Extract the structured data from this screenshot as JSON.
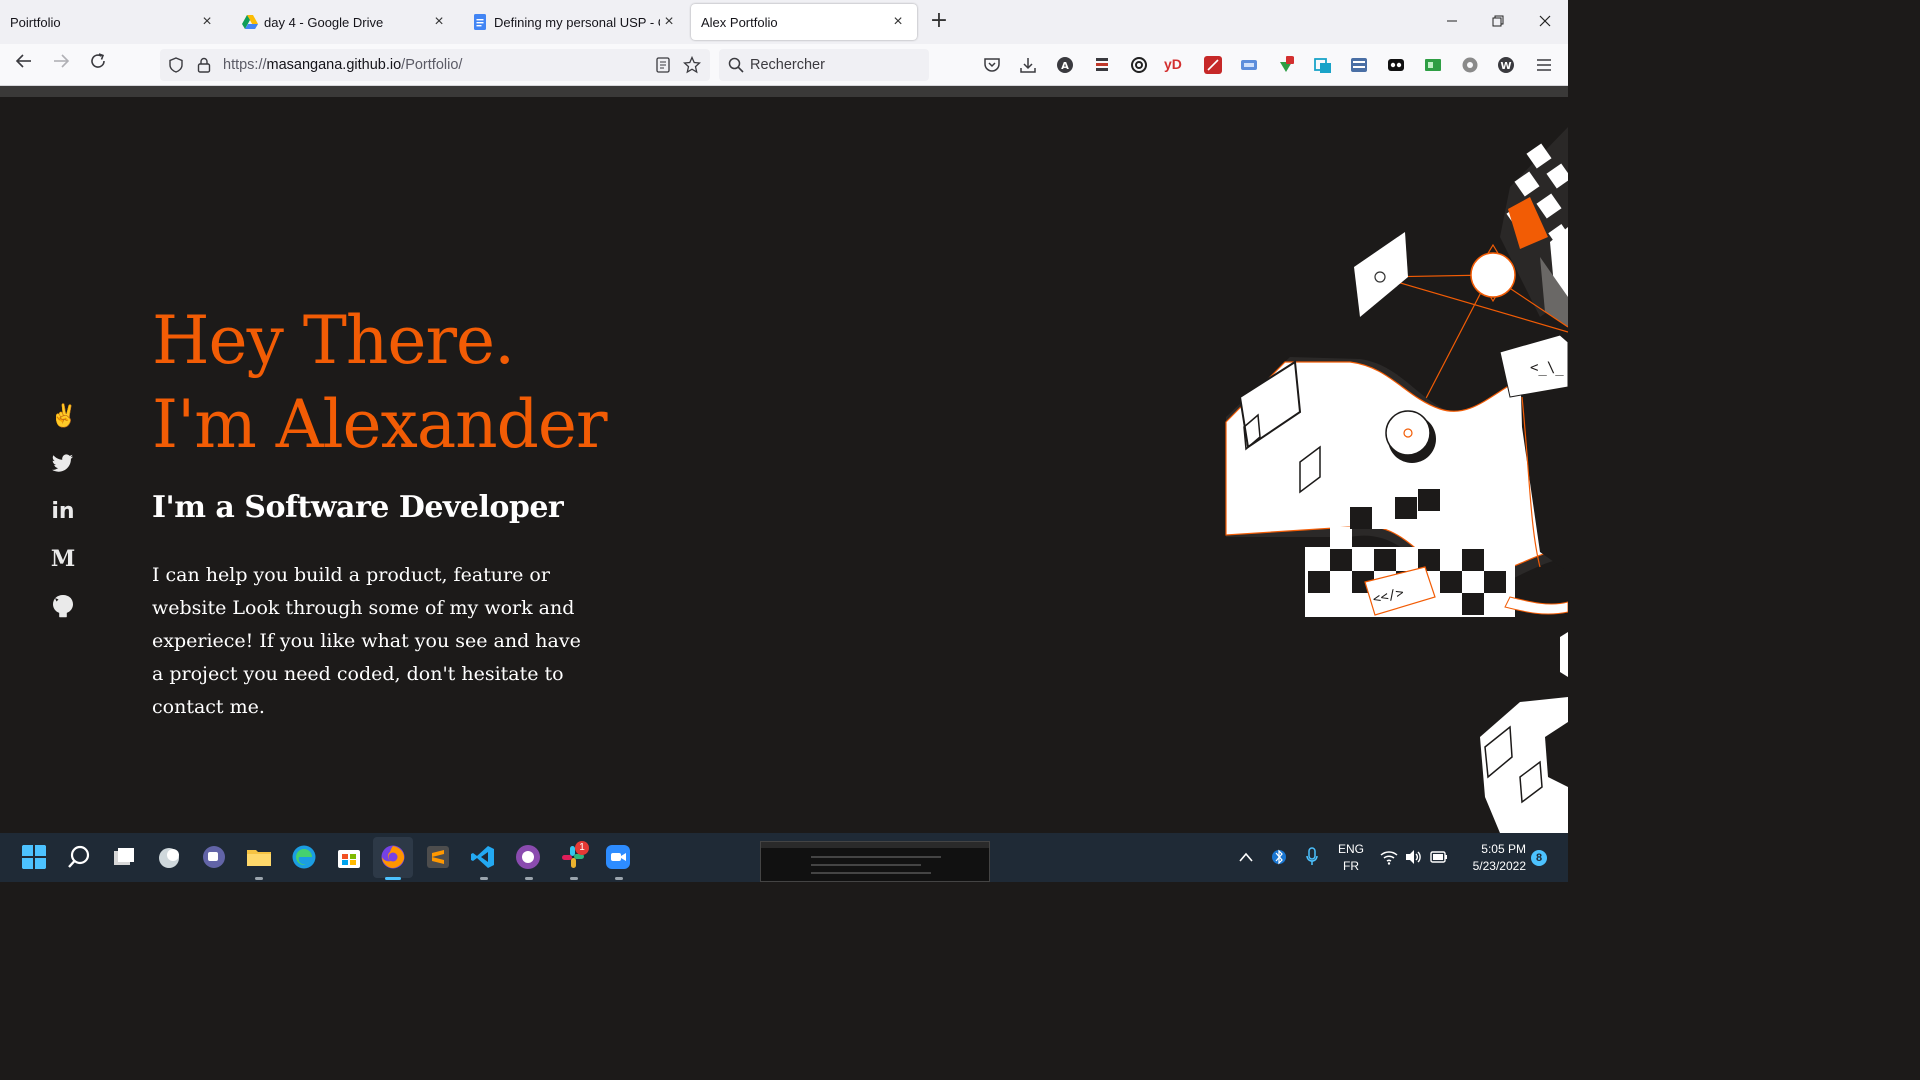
{
  "browser": {
    "tabs": [
      {
        "title": "Poirtfolio",
        "active": false
      },
      {
        "title": "day 4 - Google Drive",
        "active": false
      },
      {
        "title": "Defining my personal USP - Goo",
        "active": false
      },
      {
        "title": "Alex Portfolio",
        "active": true
      }
    ],
    "url_prefix": "https://",
    "url_host": "masangana.github.io",
    "url_path": "/Portfolio/",
    "search_placeholder": "Rechercher",
    "close_glyph": "×",
    "newtab_glyph": "+",
    "extension_yd_label": "yD"
  },
  "social": {
    "angellist_glyph": "✌",
    "medium_label": "M",
    "linkedin_label": "in"
  },
  "hero": {
    "title_line1": "Hey There.",
    "title_line2": "I'm Alexander",
    "subtitle": "I'm a Software Developer",
    "description": "I can help you build a product, feature or website Look through some of my work and experiece! If you like what you see and have a project you need coded, don't hesitate to contact me."
  },
  "art": {
    "code_tag_1": "<_\\_",
    "code_tag_2": "<</>"
  },
  "taskbar": {
    "lang_primary": "ENG",
    "lang_secondary": "FR",
    "time": "5:05 PM",
    "date": "5/23/2022",
    "slack_badge": "1",
    "notification_count": "8"
  },
  "colors": {
    "accent": "#f25c05",
    "page_bg": "#1c1a19",
    "text": "#ffffff"
  }
}
